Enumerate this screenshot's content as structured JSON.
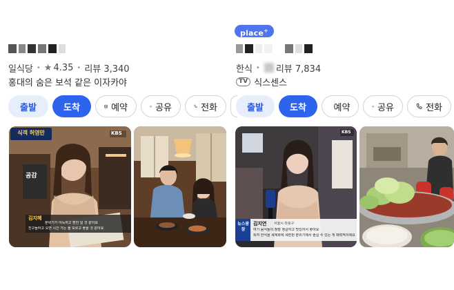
{
  "left": {
    "category": "일식당",
    "rating": "4.35",
    "reviews": "리뷰 3,340",
    "description": "홍대의 숨은 보석 같은 이자카야",
    "buttons": {
      "depart": "출발",
      "arrive": "도착",
      "reserve": "예약",
      "share": "공유",
      "call": "전화"
    },
    "photo1": {
      "banner": "식객 허영만",
      "caption_title": "김지혜",
      "caption_text": "분위기가 아늑하고 편안 일 것 같아요",
      "caption_text2": "친구들하고 오면 시간 가는 줄 모르고 좋을 것 같아요",
      "logo": "KBS",
      "sign": "공감"
    },
    "photo2": {}
  },
  "right": {
    "badge": "place",
    "badge_plus": "+",
    "category": "한식",
    "reviews": "리뷰 7,834",
    "tv_label": "TV",
    "description": "식스센스",
    "buttons": {
      "depart": "출발",
      "arrive": "도착",
      "reserve": "예약",
      "share": "공유",
      "call": "전화"
    },
    "photo1": {
      "caption_name": "김지연",
      "caption_sub": "서울시 마포구",
      "caption_text": "여기 음식들이 정말 정갈하고 맛있어서 좋아요",
      "caption_text2": "특히 한식을 세계화에 세련된 분위기에서 즐길 수 있는 게 매력적이에요",
      "news_label": "뉴스광장",
      "logo": "KBS"
    },
    "photo2": {}
  },
  "colors": {
    "primary": "#2e64ed",
    "light_button": "#e6eefc",
    "badge": "#4f74ee"
  },
  "icons": [
    "reserve-calendar-icon",
    "share-icon",
    "phone-icon",
    "star-icon"
  ]
}
